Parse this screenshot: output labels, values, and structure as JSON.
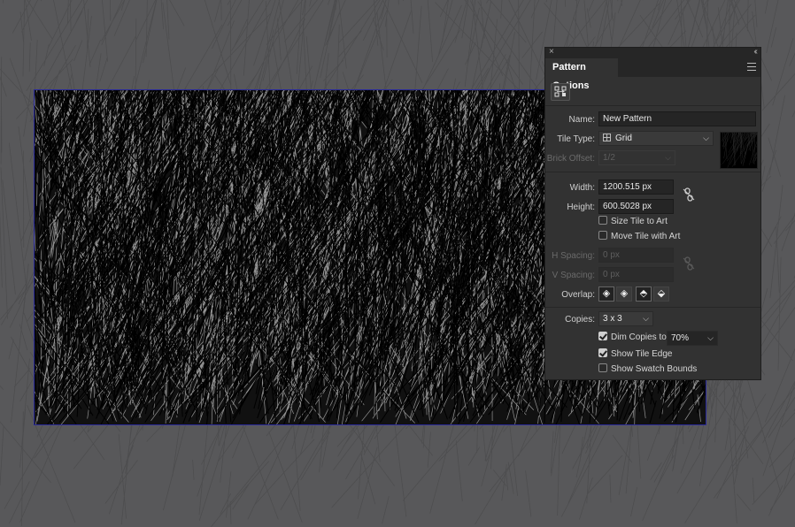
{
  "panel": {
    "title": "Pattern Options",
    "close_glyph": "×",
    "collapse_glyph": "«",
    "name_label": "Name:",
    "name_value": "New Pattern",
    "tile_type_label": "Tile Type:",
    "tile_type_value": "Grid",
    "tile_type_icon": "grid-icon",
    "brick_offset_label": "Brick Offset:",
    "brick_offset_value": "1/2",
    "width_label": "Width:",
    "width_value": "1200.515 px",
    "height_label": "Height:",
    "height_value": "600.5028 px",
    "size_tile_label": "Size Tile to Art",
    "size_tile_checked": false,
    "move_tile_label": "Move Tile with Art",
    "move_tile_checked": false,
    "h_spacing_label": "H Spacing:",
    "h_spacing_value": "0 px",
    "v_spacing_label": "V Spacing:",
    "v_spacing_value": "0 px",
    "overlap_label": "Overlap:",
    "copies_label": "Copies:",
    "copies_value": "3 x 3",
    "dim_copies_label": "Dim Copies to:",
    "dim_copies_checked": true,
    "dim_copies_value": "70%",
    "show_tile_edge_label": "Show Tile Edge",
    "show_tile_edge_checked": true,
    "show_swatch_bounds_label": "Show Swatch Bounds",
    "show_swatch_bounds_checked": false
  },
  "colors": {
    "canvas": "#58585a",
    "panel_bg": "#323232",
    "artboard_border": "#2a2a9a"
  }
}
